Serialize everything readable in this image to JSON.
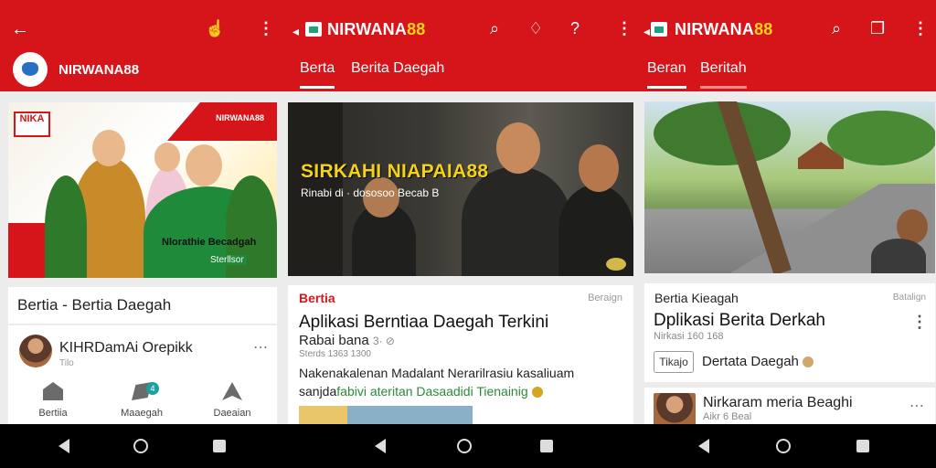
{
  "colors": {
    "primary_red": "#d6151b",
    "brand_yellow": "#ffd21a",
    "brand_green": "#1ba37a"
  },
  "panel1": {
    "header": {
      "brand": "NIRWANA88",
      "icons": [
        "back-icon",
        "hand-icon",
        "more-icon"
      ]
    },
    "hero": {
      "logo_text": "NIKA",
      "badge_text": "NIRWANA88",
      "caption": "Nlorathie Becadgah",
      "caption2": "Sterllsor"
    },
    "card_title": "Bertia - Bertia Daegah",
    "user": {
      "name": "KIHRDamAi Orepikk",
      "sub": "Tilo"
    },
    "nav": [
      {
        "label": "Bertiia",
        "icon": "house-icon"
      },
      {
        "label": "Maaegah",
        "icon": "cube-icon",
        "badge": "4"
      },
      {
        "label": "Daeaian",
        "icon": "triangle-icon"
      }
    ]
  },
  "panel2": {
    "header": {
      "brand_a": "NIRWANA",
      "brand_b": "88"
    },
    "tabs": [
      "Berta",
      "Berita Daegah"
    ],
    "hero": {
      "title": "SIRKAHI NIAPAIA88",
      "sub": "Rinabi di · dososoo Becab B"
    },
    "card": {
      "category": "Bertia",
      "tag": "Beraign",
      "headline": "Aplikasi Berntiaa Daegah Terkini",
      "meta": "Rabai bana",
      "meta_suffix": "3· ⊘",
      "meta2": "Sterds 1363 1300",
      "body1": "Nakenakalenan Madalant Nerarilrasiu kasaliuam",
      "body2_a": "sanjda",
      "body2_b": "fabivi ateritan Dasaadidi Tienainig"
    }
  },
  "panel3": {
    "header": {
      "brand_a": "NIRWANA",
      "brand_b": "88"
    },
    "tabs": [
      "Beran",
      "Beritah"
    ],
    "card": {
      "category": "Bertia Kieagah",
      "tag": "Batalign",
      "headline": "Dplikasi Berita Derkah",
      "meta": "Nirkasi 160 168",
      "chip": "Tikajo",
      "section": "Dertata Daegah"
    },
    "author": {
      "name": "Nirkaram meria Beaghi",
      "sub": "Aikr 6 Beal"
    }
  }
}
